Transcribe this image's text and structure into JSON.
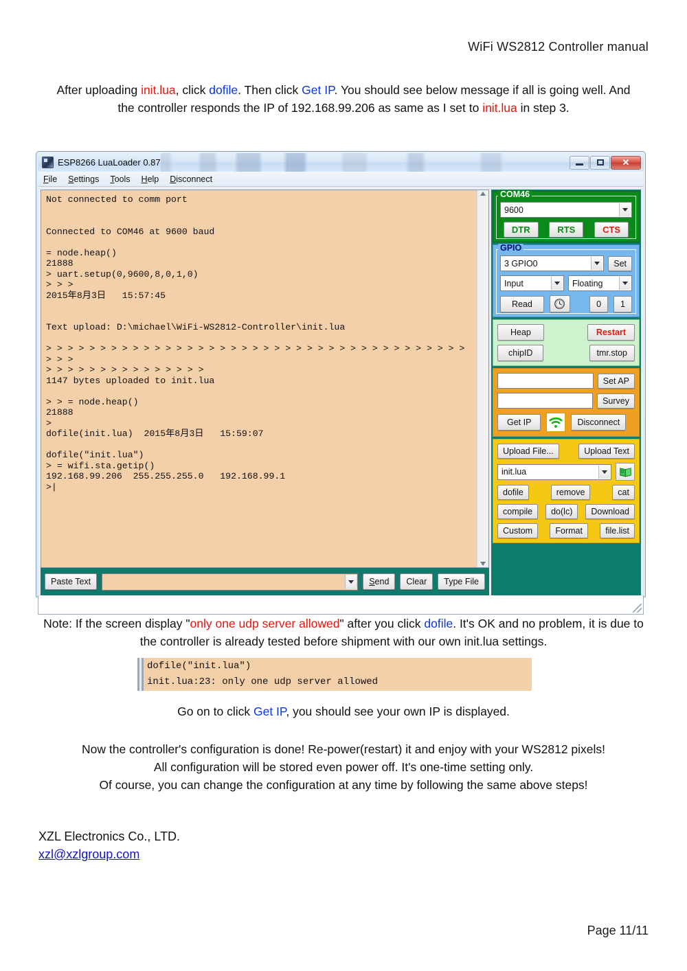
{
  "document": {
    "header": "WiFi WS2812 Controller manual",
    "footer": "Page 11/11",
    "intro_para": {
      "t1": "After uploading ",
      "r1": "init.lua",
      "t2": ", click ",
      "b1": "dofile",
      "t3": ". Then click ",
      "b2": "Get IP",
      "t4": ". You should see below message if all is going well. And the controller responds the IP of 192.168.99.206 as same as I set to ",
      "r2": "init.lua",
      "t5": " in step 3."
    },
    "note_para": {
      "t1": "Note: If the screen display \"",
      "r1": "only one udp server allowed",
      "t2": "\" after you click  ",
      "b1": "dofile",
      "t3": ".  It's OK and no problem, it is due to the controller is already tested before shipment with our own init.lua settings."
    },
    "snippet": "dofile(\"init.lua\")\ninit.lua:23: only one udp server allowed",
    "goon_para": {
      "t1": "Go on to click ",
      "b1": "Get IP",
      "t2": ", you should see your own IP is displayed."
    },
    "closing_lines": [
      "Now the controller's configuration is done! Re-power(restart) it and enjoy with your WS2812 pixels!",
      "All configuration will be stored even power off. It's one-time setting only.",
      "Of course, you can change the configuration at any time by following the same above steps!"
    ],
    "company": "XZL Electronics Co., LTD.",
    "email": "xzl@xzlgroup.com"
  },
  "app": {
    "title": "ESP8266 LuaLoader 0.87",
    "window_buttons": {
      "minimize": "minimize-button",
      "maximize": "maximize-button",
      "close": "✕"
    },
    "menu": [
      {
        "label": "File",
        "underline": "F"
      },
      {
        "label": "Settings",
        "underline": "S"
      },
      {
        "label": "Tools",
        "underline": "T"
      },
      {
        "label": "Help",
        "underline": "H"
      },
      {
        "label": "Disconnect",
        "underline": "D"
      }
    ],
    "terminal_text": "Not connected to comm port\n\n\nConnected to COM46 at 9600 baud\n\n= node.heap()\n21888\n> uart.setup(0,9600,8,0,1,0)\n> > >\n2015年8月3日   15:57:45\n\n\nText upload: D:\\michael\\WiFi-WS2812-Controller\\init.lua\n\n> > > > > > > > > > > > > > > > > > > > > > > > > > > > > > > > > > > > > > > > > >\n> > > > > > > > > > > > > > >\n1147 bytes uploaded to init.lua\n\n> > = node.heap()\n21888\n>\ndofile(init.lua)  2015年8月3日   15:59:07\n\ndofile(\"init.lua\")\n> = wifi.sta.getip()\n192.168.99.206  255.255.255.0   192.168.99.1\n>|",
    "send_bar": {
      "paste_text": "Paste Text",
      "input_value": "",
      "send": "Send",
      "send_underline": "S",
      "clear": "Clear",
      "type_file": "Type File"
    },
    "com_group": {
      "legend": "COM46",
      "baud": "9600",
      "dtr": "DTR",
      "rts": "RTS",
      "cts": "CTS"
    },
    "gpio_group": {
      "legend": "GPIO",
      "pin": "3 GPIO0",
      "set": "Set",
      "direction": "Input",
      "mode": "Floating",
      "read": "Read",
      "clock_icon": "clock-icon",
      "zero": "0",
      "one": "1"
    },
    "sys_group": {
      "heap": "Heap",
      "restart": "Restart",
      "chipid": "chipID",
      "tmrstop": "tmr.stop"
    },
    "wifi_group": {
      "ssid_value": "",
      "password_value": "",
      "set_ap": "Set AP",
      "survey": "Survey",
      "get_ip": "Get IP",
      "wifi_icon": "wifi-signal-icon",
      "disconnect": "Disconnect"
    },
    "file_group": {
      "upload_file": "Upload File...",
      "upload_text": "Upload Text",
      "filename": "init.lua",
      "file_icon": "open-book-icon",
      "dofile": "dofile",
      "remove": "remove",
      "cat": "cat",
      "compile": "compile",
      "dolc": "do(lc)",
      "download": "Download",
      "custom": "Custom",
      "format": "Format",
      "filelist": "file.list"
    },
    "statusbar_text": ""
  },
  "colors": {
    "terminal_bg": "#f3cfaa",
    "teal_panel": "#0f7d6e",
    "com_green": "#0a8a19",
    "gpio_blue": "#76b7ee",
    "sys_green": "#cdf2cd",
    "wifi_orange": "#f0a020",
    "file_yellow": "#f5c913",
    "link_blue": "#0b35e8",
    "alert_red": "#e8150f"
  }
}
